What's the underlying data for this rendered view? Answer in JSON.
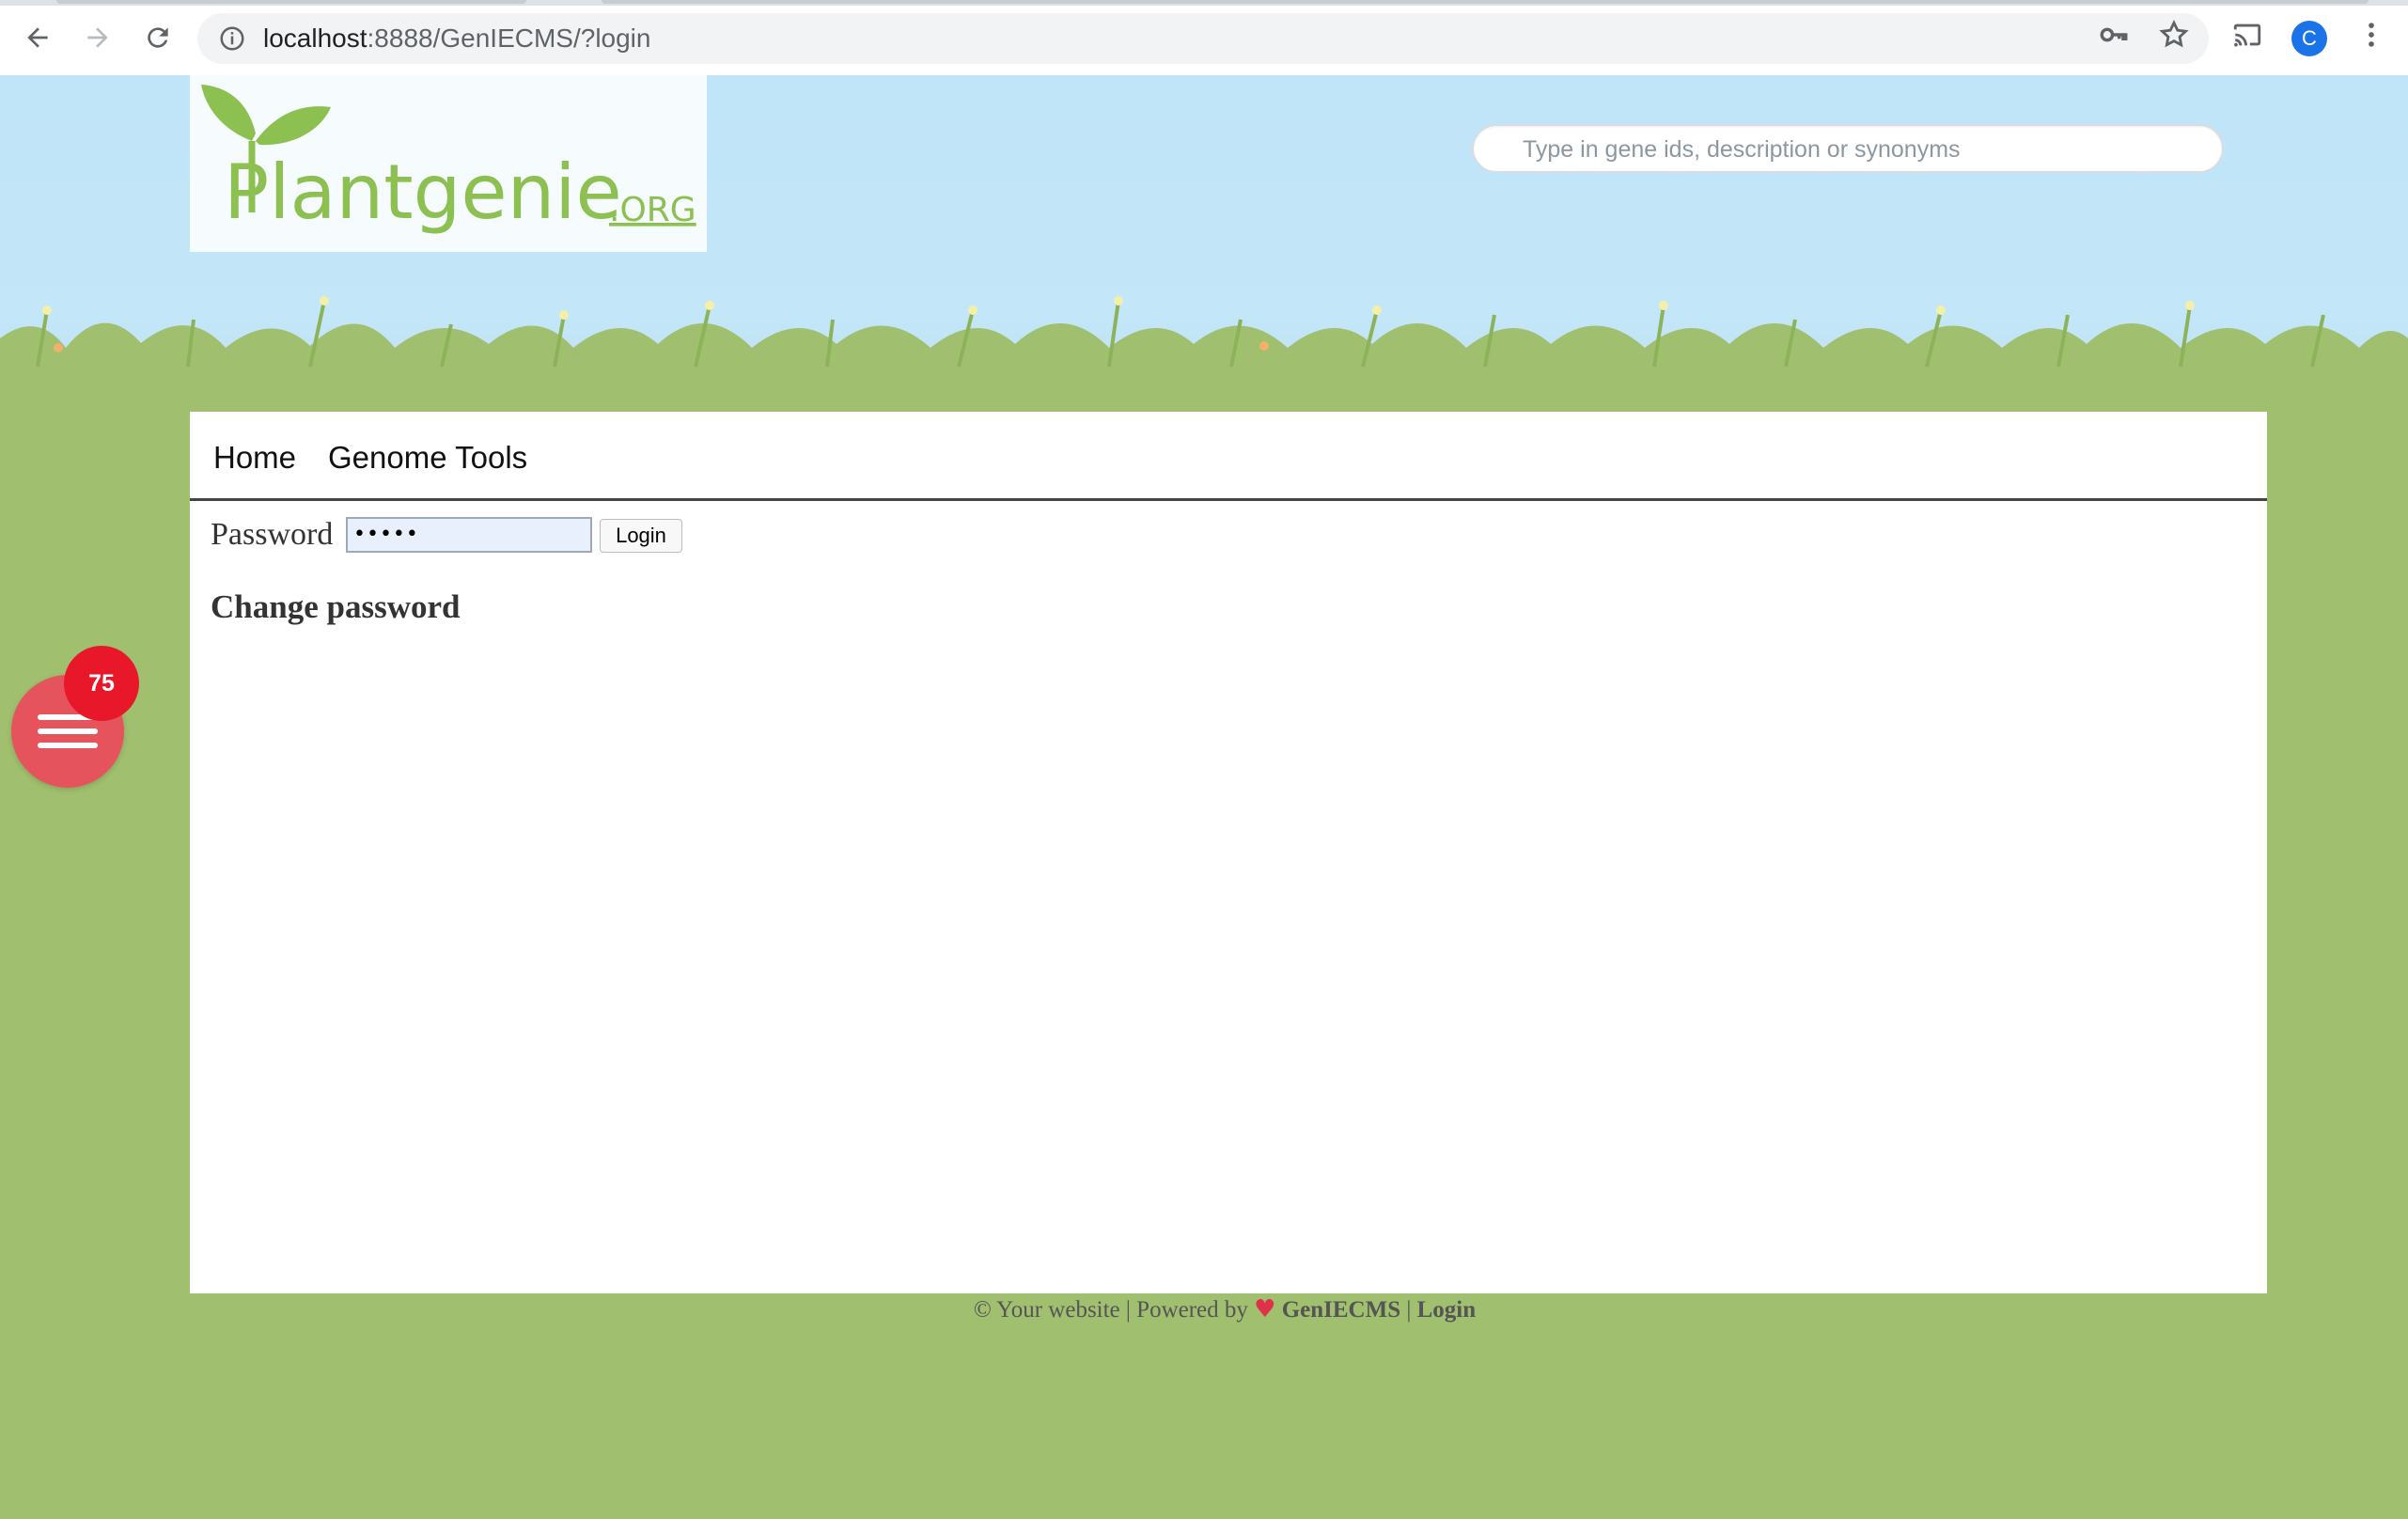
{
  "browser": {
    "url_host": "localhost",
    "url_path": ":8888/GenIECMS/?login",
    "profile_initial": "C"
  },
  "site": {
    "logo_main": "Plantgenie",
    "logo_suffix": ".ORG",
    "search_placeholder": "Type in gene ids, description or synonyms"
  },
  "menu": {
    "items": [
      {
        "label": "Home"
      },
      {
        "label": "Genome Tools"
      }
    ]
  },
  "login": {
    "password_label": "Password",
    "password_value": "•••••",
    "button_label": "Login",
    "change_password": "Change password"
  },
  "footer": {
    "prefix": "© Your website | Powered by",
    "heart": "♥",
    "cms": "GenIECMS",
    "separator": "|",
    "login": "Login"
  },
  "fab": {
    "badge_count": "75"
  },
  "colors": {
    "sky": "#c0e4f8",
    "grass": "#a0bf6f",
    "fab": "#e5545d",
    "badge": "#e8182a",
    "logo_green": "#8cc152"
  }
}
